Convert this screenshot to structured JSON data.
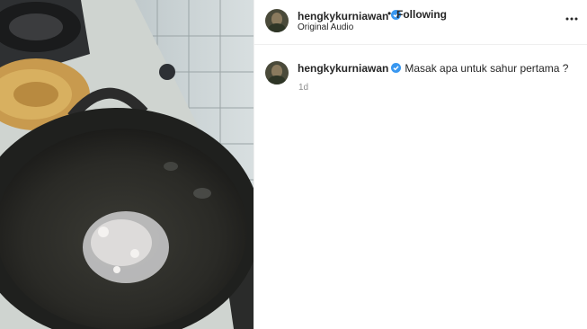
{
  "post": {
    "username": "hengkykurniawan",
    "separator": "•",
    "follow_status": "Following",
    "audio": "Original Audio",
    "verified_color": "#3897f0"
  },
  "comment": {
    "username": "hengkykurniawan",
    "caption": "Masak apa untuk sahur pertama ?",
    "time": "1d"
  },
  "icons": {
    "more": "more-options-icon",
    "verified": "verified-badge-icon"
  }
}
